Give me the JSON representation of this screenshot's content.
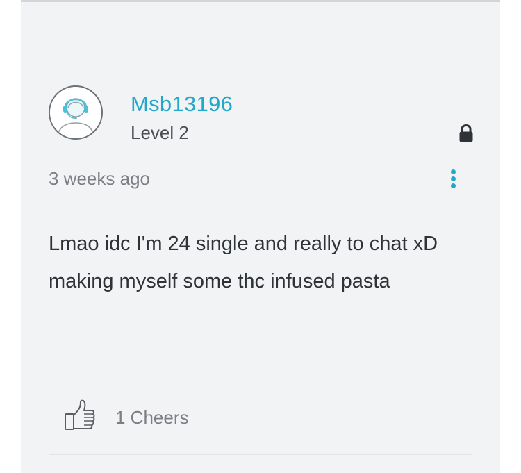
{
  "post": {
    "author": {
      "username": "Msb13196",
      "level": "Level 2",
      "avatar_icon": "support-agent-headset-avatar-icon"
    },
    "timestamp": "3 weeks ago",
    "locked_icon": "lock-icon",
    "menu_icon": "vertical-ellipsis-icon",
    "body": "Lmao idc I'm 24 single and really to chat xD making myself some thc infused pasta",
    "cheers": {
      "icon": "thumbs-up-icon",
      "label": "1 Cheers"
    }
  },
  "colors": {
    "accent": "#22a9c9",
    "card_background": "#f2f3f5",
    "text_primary": "#2f3237",
    "text_secondary": "#7b7f85"
  }
}
